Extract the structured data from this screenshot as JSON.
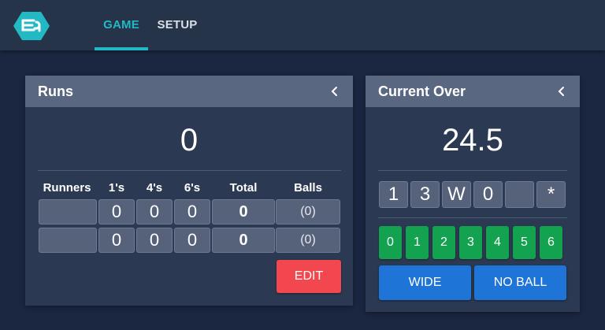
{
  "nav": {
    "tabs": [
      {
        "label": "GAME",
        "active": true
      },
      {
        "label": "SETUP",
        "active": false
      }
    ],
    "accent_color": "#22b8c4",
    "logo_icon": "cricket-logo-icon"
  },
  "runs_panel": {
    "title": "Runs",
    "total_runs": "0",
    "columns": [
      "Runners",
      "1's",
      "4's",
      "6's",
      "Total",
      "Balls"
    ],
    "rows": [
      {
        "runner": "",
        "ones": "0",
        "fours": "0",
        "sixes": "0",
        "total": "0",
        "balls": "(0)"
      },
      {
        "runner": "",
        "ones": "0",
        "fours": "0",
        "sixes": "0",
        "total": "0",
        "balls": "(0)"
      }
    ],
    "edit_label": "EDIT",
    "collapse_icon": "chevron-left-icon"
  },
  "over_panel": {
    "title": "Current Over",
    "over_value": "24.5",
    "balls": [
      "1",
      "3",
      "W",
      "0",
      "",
      "*"
    ],
    "score_buttons": [
      "0",
      "1",
      "2",
      "3",
      "4",
      "5",
      "6"
    ],
    "wide_label": "WIDE",
    "no_ball_label": "NO BALL",
    "collapse_icon": "chevron-left-icon"
  },
  "colors": {
    "background": "#1b2640",
    "card": "#2b3a52",
    "card_header": "#5a6780",
    "score_green": "#13a24f",
    "extra_blue": "#1f74d8",
    "edit_red": "#f2474f"
  }
}
